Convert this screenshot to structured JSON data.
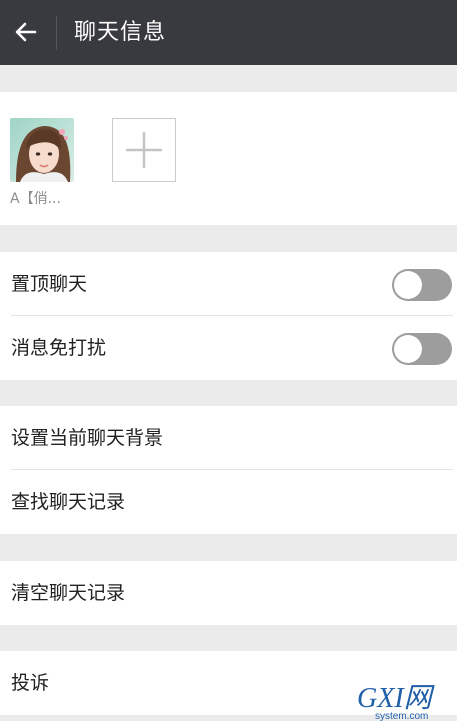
{
  "header": {
    "title": "聊天信息",
    "back_icon": "arrow-left-icon"
  },
  "members": [
    {
      "name": "A【俏..."
    }
  ],
  "add_member_icon": "plus-icon",
  "settings": {
    "pin_chat": {
      "label": "置顶聊天",
      "enabled": false
    },
    "mute": {
      "label": "消息免打扰",
      "enabled": false
    },
    "chat_background": "设置当前聊天背景",
    "search_history": "查找聊天记录",
    "clear_history": "清空聊天记录",
    "report": "投诉"
  },
  "watermark": {
    "main": "GXI网",
    "sub": "system.com"
  },
  "colors": {
    "header_bg": "#393a3f",
    "page_bg": "#ebebeb",
    "toggle_off": "#9d9d9d",
    "watermark_blue": "#1f5fa8"
  }
}
